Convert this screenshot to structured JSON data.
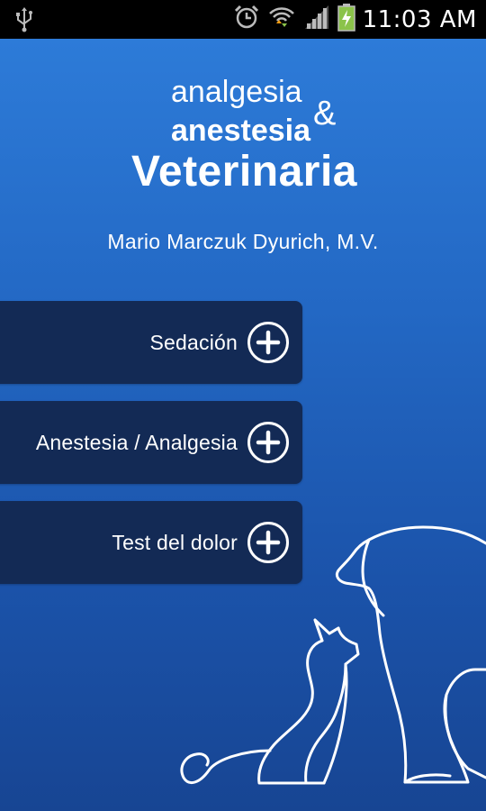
{
  "status_bar": {
    "time": "11:03 AM",
    "icons": [
      "usb-icon",
      "alarm-icon",
      "wifi-icon",
      "signal-icon",
      "battery-charging-icon"
    ]
  },
  "logo": {
    "line1": "analgesia",
    "ampersand": "&",
    "line2": "anestesia",
    "line3": "Veterinaria"
  },
  "author": "Mario Marczuk Dyurich, M.V.",
  "menu": [
    {
      "label": "Sedación",
      "icon": "plus-circle-icon"
    },
    {
      "label": "Anestesia / Analgesia",
      "icon": "plus-circle-icon"
    },
    {
      "label": "Test del dolor",
      "icon": "plus-circle-icon"
    }
  ],
  "colors": {
    "background_top": "#2d7bd8",
    "background_bottom": "#174593",
    "button": "#132a55",
    "text": "#ffffff"
  }
}
